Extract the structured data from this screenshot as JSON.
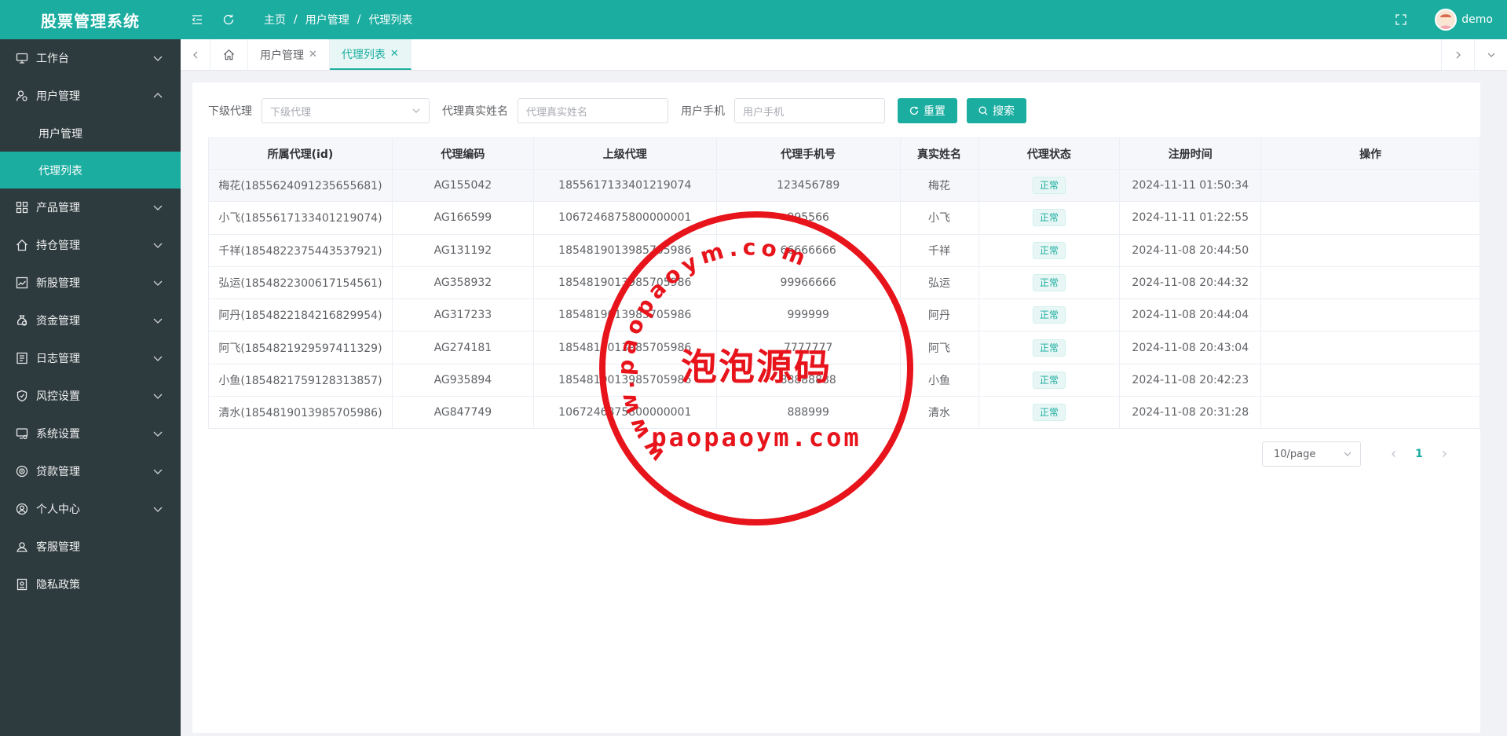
{
  "app": {
    "title": "股票管理系统"
  },
  "sidebar": {
    "items": [
      {
        "label": "工作台",
        "icon": "monitor-icon",
        "expanded": false
      },
      {
        "label": "用户管理",
        "icon": "user-group-icon",
        "expanded": true,
        "children": [
          {
            "label": "用户管理",
            "active": false
          },
          {
            "label": "代理列表",
            "active": true
          }
        ]
      },
      {
        "label": "产品管理",
        "icon": "grid-icon",
        "expanded": false
      },
      {
        "label": "持仓管理",
        "icon": "home-icon",
        "expanded": false
      },
      {
        "label": "新股管理",
        "icon": "chart-icon",
        "expanded": false
      },
      {
        "label": "资金管理",
        "icon": "money-bag-icon",
        "expanded": false
      },
      {
        "label": "日志管理",
        "icon": "log-icon",
        "expanded": false
      },
      {
        "label": "风控设置",
        "icon": "shield-icon",
        "expanded": false
      },
      {
        "label": "系统设置",
        "icon": "settings-monitor-icon",
        "expanded": false
      },
      {
        "label": "贷款管理",
        "icon": "loan-icon",
        "expanded": false
      },
      {
        "label": "个人中心",
        "icon": "user-circle-icon",
        "expanded": false
      },
      {
        "label": "客服管理",
        "icon": "service-icon",
        "expanded": null
      },
      {
        "label": "隐私政策",
        "icon": "privacy-icon",
        "expanded": null
      }
    ]
  },
  "header": {
    "breadcrumb": [
      "主页",
      "用户管理",
      "代理列表"
    ],
    "user": "demo"
  },
  "tabs": [
    {
      "label": "用户管理",
      "active": false
    },
    {
      "label": "代理列表",
      "active": true
    }
  ],
  "filters": {
    "sub_agent_label": "下级代理",
    "sub_agent_placeholder": "下级代理",
    "real_name_label": "代理真实姓名",
    "real_name_placeholder": "代理真实姓名",
    "phone_label": "用户手机",
    "phone_placeholder": "用户手机",
    "reset_label": "重置",
    "search_label": "搜索"
  },
  "table": {
    "columns": [
      "所属代理(id)",
      "代理编码",
      "上级代理",
      "代理手机号",
      "真实姓名",
      "代理状态",
      "注册时间",
      "操作"
    ],
    "rows": [
      {
        "owner": "梅花(1855624091235655681)",
        "code": "AG155042",
        "parent": "1855617133401219074",
        "phone": "123456789",
        "name": "梅花",
        "status": "正常",
        "time": "2024-11-11 01:50:34"
      },
      {
        "owner": "小飞(1855617133401219074)",
        "code": "AG166599",
        "parent": "1067246875800000001",
        "phone": "995566",
        "name": "小飞",
        "status": "正常",
        "time": "2024-11-11 01:22:55"
      },
      {
        "owner": "千祥(1854822375443537921)",
        "code": "AG131192",
        "parent": "1854819013985705986",
        "phone": "66666666",
        "name": "千祥",
        "status": "正常",
        "time": "2024-11-08 20:44:50"
      },
      {
        "owner": "弘运(1854822300617154561)",
        "code": "AG358932",
        "parent": "1854819013985705986",
        "phone": "99966666",
        "name": "弘运",
        "status": "正常",
        "time": "2024-11-08 20:44:32"
      },
      {
        "owner": "阿丹(1854822184216829954)",
        "code": "AG317233",
        "parent": "1854819013985705986",
        "phone": "999999",
        "name": "阿丹",
        "status": "正常",
        "time": "2024-11-08 20:44:04"
      },
      {
        "owner": "阿飞(1854821929597411329)",
        "code": "AG274181",
        "parent": "1854819013985705986",
        "phone": "7777777",
        "name": "阿飞",
        "status": "正常",
        "time": "2024-11-08 20:43:04"
      },
      {
        "owner": "小鱼(1854821759128313857)",
        "code": "AG935894",
        "parent": "1854819013985705986",
        "phone": "88888888",
        "name": "小鱼",
        "status": "正常",
        "time": "2024-11-08 20:42:23"
      },
      {
        "owner": "清水(1854819013985705986)",
        "code": "AG847749",
        "parent": "1067246875800000001",
        "phone": "888999",
        "name": "清水",
        "status": "正常",
        "time": "2024-11-08 20:31:28"
      }
    ]
  },
  "pagination": {
    "page_size": "10/page",
    "current_page": "1"
  },
  "watermark": {
    "top_arc": "www.paopaoym.com",
    "center": "泡泡源码",
    "bottom": "paopaoym.com",
    "color": "#e8141c"
  },
  "colors": {
    "primary": "#1aada0",
    "sidebar": "#2d3a3e"
  }
}
